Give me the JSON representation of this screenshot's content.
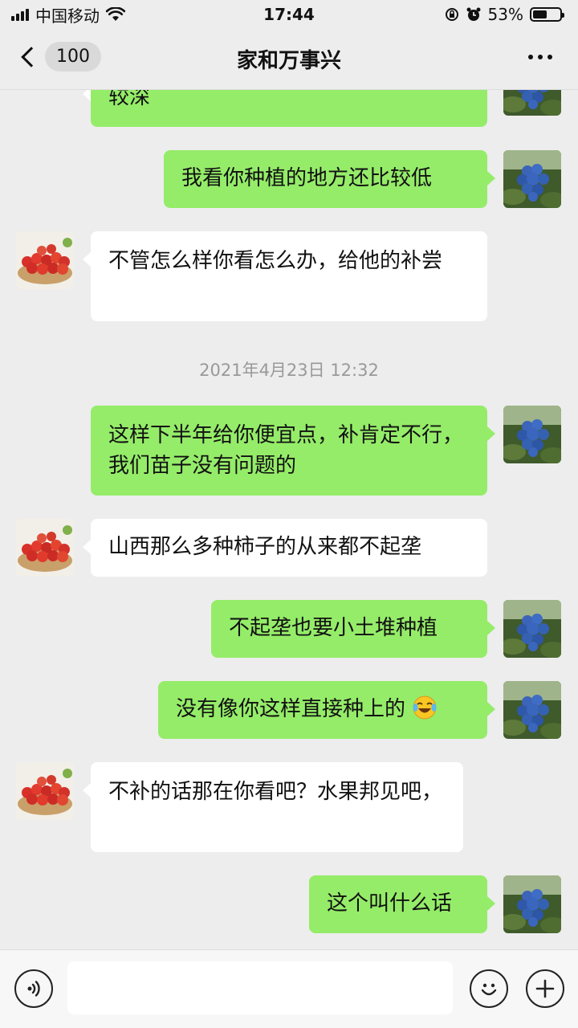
{
  "status_bar": {
    "carrier": "中国移动",
    "time": "17:44",
    "battery": "53%",
    "battery_level": 0.53
  },
  "nav": {
    "unread_count": "100",
    "title": "家和万事兴"
  },
  "messages": [
    {
      "side": "in_partial",
      "text": "较深"
    },
    {
      "side": "out",
      "text": "我看你种植的地方还比较低"
    },
    {
      "side": "in",
      "text": "不管怎么样你看怎么办，给他的补尝"
    },
    {
      "type": "timestamp",
      "text": "2021年4月23日 12:32"
    },
    {
      "side": "out",
      "text": "这样下半年给你便宜点，补肯定不行，我们苗子没有问题的"
    },
    {
      "side": "in",
      "text": "山西那么多种柿子的从来都不起垄"
    },
    {
      "side": "out",
      "text": "不起垄也要小土堆种植"
    },
    {
      "side": "out",
      "text": "没有像你这样直接种上的",
      "emoji": "face-with-tears-of-joy"
    },
    {
      "side": "in",
      "text": "不补的话那在你看吧？水果邦见吧，"
    },
    {
      "side": "out",
      "text": "这个叫什么话"
    }
  ],
  "icons": {
    "voice": "voice-icon",
    "emoji": "emoji-icon",
    "plus": "plus-icon"
  },
  "colors": {
    "outgoing_bubble": "#95ec69",
    "incoming_bubble": "#ffffff",
    "background": "#ededed"
  }
}
